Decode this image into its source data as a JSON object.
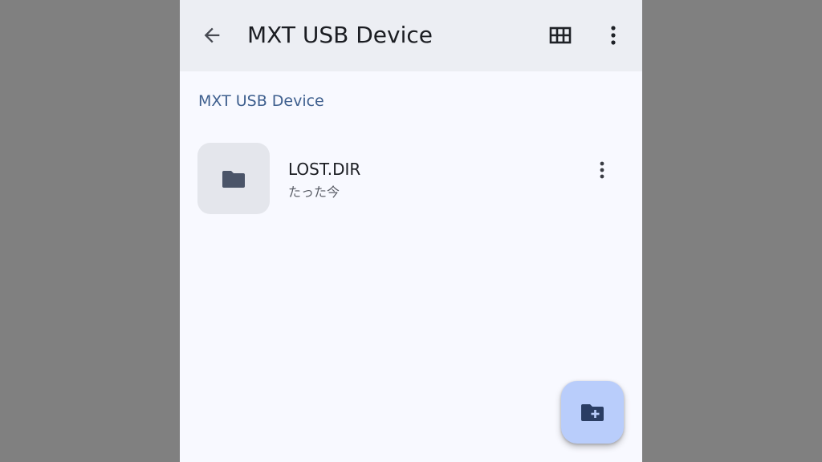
{
  "app_bar": {
    "title": "MXT USB Device",
    "back_icon": "arrow-back-icon",
    "view_toggle_icon": "grid-view-icon",
    "overflow_icon": "more-vert-icon"
  },
  "breadcrumb": {
    "label": "MXT USB Device"
  },
  "files": [
    {
      "name": "LOST.DIR",
      "modified": "たった今",
      "icon": "folder-icon",
      "menu_icon": "more-vert-icon"
    }
  ],
  "fab": {
    "icon": "create-new-folder-icon"
  },
  "colors": {
    "background": "#808080",
    "surface": "#f8f9ff",
    "app_bar": "#eceef3",
    "breadcrumb_text": "#3e5f8e",
    "thumb_bg": "#e4e6ec",
    "folder_icon": "#4a5468",
    "fab_bg": "#b9cdfb",
    "fab_icon": "#2a3d63"
  }
}
